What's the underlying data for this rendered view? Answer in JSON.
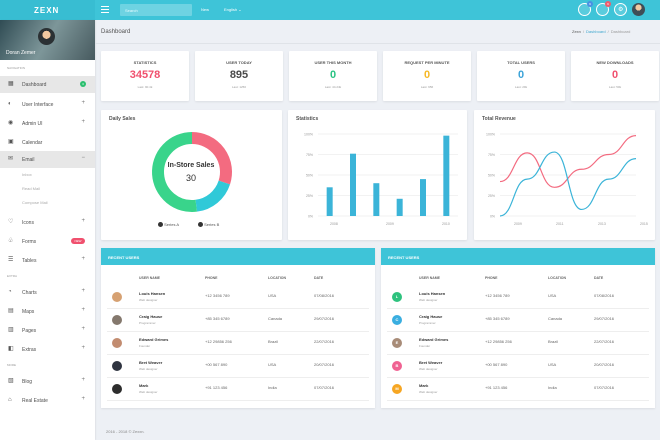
{
  "topbar": {
    "brand": "ZEXN",
    "search_placeholder": "Search",
    "links": [
      "New",
      "English ⌄"
    ],
    "badges": [
      "9",
      "9"
    ],
    "colors": {
      "main": "#3ec4d8",
      "badge_blue": "#4a90e2",
      "badge_red": "#f15b6c"
    }
  },
  "sidebar": {
    "user_name": "Doran Zemer",
    "sections": {
      "navigation": "NAVIGATION",
      "extra": "EXTRA",
      "more": "MORE"
    },
    "items": [
      {
        "label": "Dashboard",
        "icon": "dashboard-icon",
        "suffix": "3"
      },
      {
        "label": "User Interface",
        "icon": "user-interface-icon",
        "suffix": "+"
      },
      {
        "label": "Admin UI",
        "icon": "admin-icon",
        "suffix": "+"
      },
      {
        "label": "Calendar",
        "icon": "calendar-icon",
        "suffix": ""
      },
      {
        "label": "Email",
        "icon": "email-icon",
        "suffix": "−"
      },
      {
        "label": "Icons",
        "icon": "heart-icon",
        "suffix": "+"
      },
      {
        "label": "Forms",
        "icon": "forms-icon",
        "suffix": "NEW"
      },
      {
        "label": "Tables",
        "icon": "tables-icon",
        "suffix": "+"
      },
      {
        "label": "Charts",
        "icon": "charts-icon",
        "suffix": "+"
      },
      {
        "label": "Maps",
        "icon": "maps-icon",
        "suffix": "+"
      },
      {
        "label": "Pages",
        "icon": "pages-icon",
        "suffix": "+"
      },
      {
        "label": "Extras",
        "icon": "extras-icon",
        "suffix": "+"
      },
      {
        "label": "Blog",
        "icon": "blog-icon",
        "suffix": "+"
      },
      {
        "label": "Real Estate",
        "icon": "real-estate-icon",
        "suffix": "+"
      }
    ],
    "email_subitems": [
      "Inbox",
      "Read Mail",
      "Compose Mail"
    ]
  },
  "header": {
    "title": "Dashboard",
    "breadcrumb": [
      "Zexn",
      "Dashboard",
      "Dashboard"
    ]
  },
  "stats": [
    {
      "label": "STATISTICS",
      "value": "34578",
      "last": "Last: 90.4k",
      "color": "#f0506e"
    },
    {
      "label": "USER TODAY",
      "value": "895",
      "last": "Last: 1250",
      "color": "#4a4a4a"
    },
    {
      "label": "USER THIS MONTH",
      "value": "0",
      "last": "Last: 44.24k",
      "color": "#29c383"
    },
    {
      "label": "REQUEST PER MINUTE",
      "value": "0",
      "last": "Last: 956",
      "color": "#f6b825"
    },
    {
      "label": "TOTAL USERS",
      "value": "0",
      "last": "Last: 29k",
      "color": "#3ca3d8"
    },
    {
      "label": "NEW DOWNLOADS",
      "value": "0",
      "last": "Last: 50k",
      "color": "#f0506e"
    }
  ],
  "daily_sales": {
    "title": "Daily Sales",
    "center_label": "In-Store Sales",
    "center_value": "30"
  },
  "statistics_chart": {
    "title": "Statistics"
  },
  "revenue_chart": {
    "title": "Total Revenue"
  },
  "chart_data": [
    {
      "type": "pie",
      "title": "Daily Sales",
      "labels": [
        "In-Store Sales",
        "Series B",
        "Series A"
      ],
      "values": [
        30,
        18,
        52
      ],
      "colors": [
        "#f36b80",
        "#30c9d8",
        "#39d48b"
      ],
      "legend": [
        "Series A",
        "Series B"
      ]
    },
    {
      "type": "bar",
      "title": "Statistics",
      "categories": [
        "1",
        "2",
        "3",
        "4",
        "5",
        "6"
      ],
      "values": [
        35,
        76,
        40,
        21,
        45,
        98
      ],
      "xlabels": [
        "2008",
        "2009",
        "2010"
      ],
      "yticks": [
        "0%",
        "25%",
        "50%",
        "75%",
        "100%"
      ],
      "ylim": [
        0,
        100
      ],
      "color": "#3bb4d8"
    },
    {
      "type": "line",
      "title": "Total Revenue",
      "x": [
        2009,
        2010,
        2011,
        2012,
        2013,
        2014
      ],
      "series": [
        {
          "values": [
            42,
            77,
            35,
            57,
            75,
            98
          ],
          "color": "#f36b80"
        },
        {
          "values": [
            0,
            45,
            78,
            8,
            45,
            70
          ],
          "color": "#3bb4d8"
        }
      ],
      "xticks": [
        "2009",
        "2011",
        "2013",
        "2015"
      ],
      "yticks": [
        "0%",
        "25%",
        "50%",
        "75%",
        "100%"
      ],
      "ylim": [
        0,
        100
      ]
    }
  ],
  "recent_users": {
    "title": "RECENT USERS",
    "columns": [
      "USER NAME",
      "PHONE",
      "LOCATION",
      "DATE"
    ],
    "left_rows": [
      {
        "initial": "",
        "name": "Louis Hansen",
        "role": "Web designer",
        "phone": "+12 3456 789",
        "location": "USA",
        "date": "07/08/2016"
      },
      {
        "initial": "",
        "name": "Craig Hause",
        "role": "Programmer",
        "phone": "+85 345 6789",
        "location": "Canada",
        "date": "29/07/2016"
      },
      {
        "initial": "",
        "name": "Edward Grimes",
        "role": "Founder",
        "phone": "+12 29856 256",
        "location": "Brazil",
        "date": "22/07/2016"
      },
      {
        "initial": "",
        "name": "Bret Weaver",
        "role": "Web designer",
        "phone": "+00 567 890",
        "location": "USA",
        "date": "20/07/2016"
      },
      {
        "initial": "",
        "name": "Mark",
        "role": "Web designer",
        "phone": "+91 123 456",
        "location": "India",
        "date": "07/07/2016"
      }
    ],
    "right_rows": [
      {
        "initial": "L",
        "name": "Louis Hansen",
        "role": "Web designer",
        "phone": "+12 3456 789",
        "location": "USA",
        "date": "07/08/2016"
      },
      {
        "initial": "C",
        "name": "Craig Hause",
        "role": "Programmer",
        "phone": "+85 345 6789",
        "location": "Canada",
        "date": "29/07/2016"
      },
      {
        "initial": "E",
        "name": "Edward Grimes",
        "role": "Founder",
        "phone": "+12 29856 256",
        "location": "Brazil",
        "date": "22/07/2016"
      },
      {
        "initial": "B",
        "name": "Bret Weaver",
        "role": "Web designer",
        "phone": "+00 567 890",
        "location": "USA",
        "date": "20/07/2016"
      },
      {
        "initial": "M",
        "name": "Mark",
        "role": "Web designer",
        "phone": "+91 123 456",
        "location": "India",
        "date": "07/07/2016"
      }
    ],
    "right_avatar_colors": [
      "#2ec27e",
      "#3aaee0",
      "#a88c78",
      "#f06292",
      "#f6a623"
    ]
  },
  "footer": "2016 - 2018 © Zexxn."
}
